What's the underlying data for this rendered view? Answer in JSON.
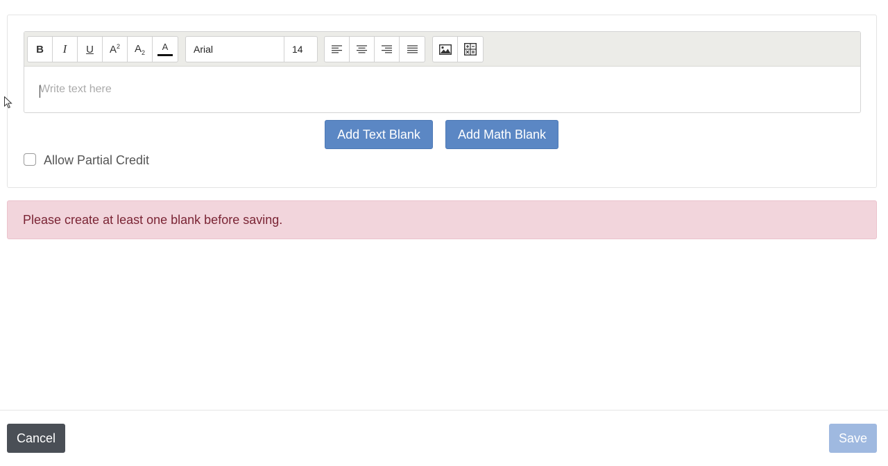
{
  "toolbar": {
    "bold": "B",
    "italic": "I",
    "underline": "U",
    "superscript_base": "A",
    "superscript_mark": "2",
    "subscript_base": "A",
    "subscript_mark": "2",
    "font_color": "A",
    "font_color_value": "#111111",
    "font_family": "Arial",
    "font_size": "14",
    "align_icons": [
      "align-left-icon",
      "align-center-icon",
      "align-right-icon",
      "align-justify-icon"
    ],
    "insert_icons": [
      "image-icon",
      "math-equation-icon"
    ]
  },
  "editor": {
    "placeholder": "Write text here"
  },
  "actions": {
    "add_text_blank": "Add Text Blank",
    "add_math_blank": "Add Math Blank"
  },
  "options": {
    "allow_partial_credit": "Allow Partial Credit",
    "allow_partial_credit_checked": false
  },
  "alert": {
    "message": "Please create at least one blank before saving."
  },
  "footer": {
    "cancel": "Cancel",
    "save": "Save"
  },
  "colors": {
    "primary": "#5b87c4",
    "primary_disabled": "#9fb9e0",
    "danger_bg": "#f2d5dc",
    "danger_text": "#7a2434",
    "dark_button": "#4a4f56"
  }
}
